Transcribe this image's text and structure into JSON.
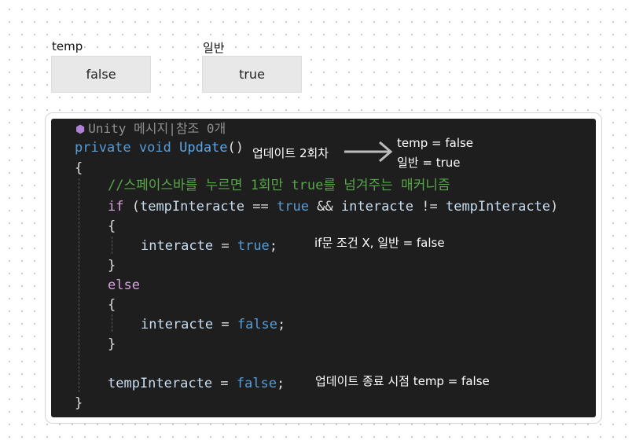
{
  "variables": [
    {
      "name": "temp",
      "value": "false"
    },
    {
      "name": "일반",
      "value": "true"
    }
  ],
  "code": {
    "codelens": "Unity 메시지|참조 0개",
    "sig_private": "private",
    "sig_void": "void",
    "sig_update": "Update",
    "sig_parens": "()",
    "brace_open": "{",
    "brace_close": "}",
    "comment": "//스페이스바를 누르면 1회만 true를 넘겨주는 매커니즘",
    "kw_if": "if",
    "if_paren_open": " (",
    "var_temp_interacte": "tempInteracte",
    "op_eq": " == ",
    "kw_true": "true",
    "op_and": " && ",
    "var_interacte": "interacte",
    "op_neq": " != ",
    "paren_close": ")",
    "op_assign": " = ",
    "kw_false": "false",
    "semicolon": ";",
    "kw_else": "else"
  },
  "annotations": {
    "update_second": "업데이트 2회차",
    "result_temp": "temp = false",
    "result_normal": "일반 = true",
    "if_condition": "if문 조건  X, 일반 = false",
    "update_end": "업데이트 종료 시점 temp = false"
  }
}
